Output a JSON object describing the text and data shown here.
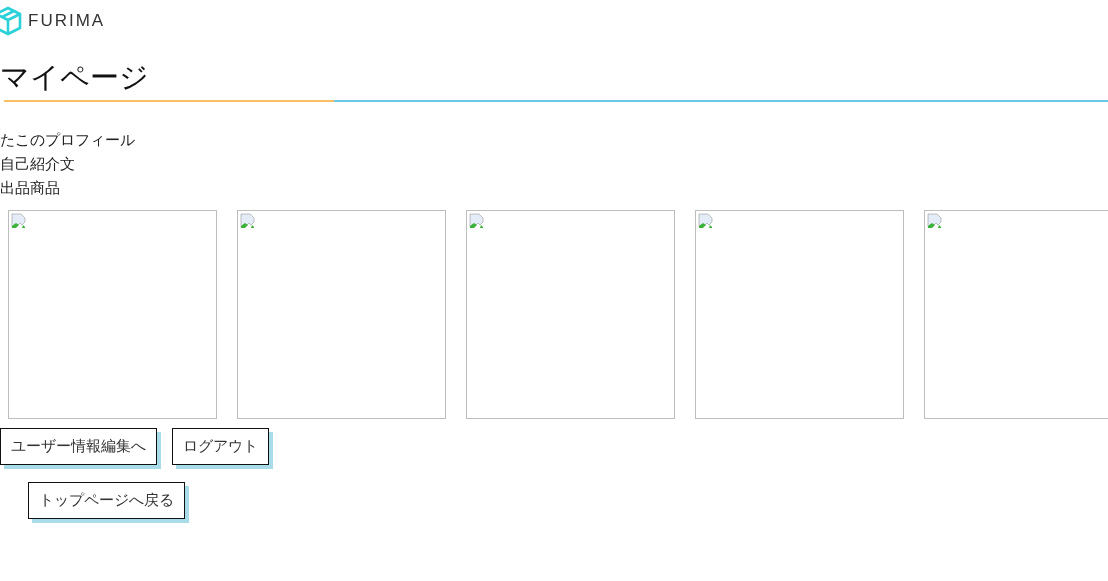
{
  "header": {
    "logo_text": "FURIMA"
  },
  "title": "マイページ",
  "profile_lines": [
    "たこのプロフィール",
    "自己紹介文",
    "出品商品"
  ],
  "products": [
    {
      "kind": "broken_image"
    },
    {
      "kind": "broken_image"
    },
    {
      "kind": "broken_image"
    },
    {
      "kind": "broken_image"
    },
    {
      "kind": "broken_image"
    }
  ],
  "buttons": [
    "ユーザー情報編集へ",
    "ログアウト"
  ],
  "back_button": "トップページへ戻る"
}
